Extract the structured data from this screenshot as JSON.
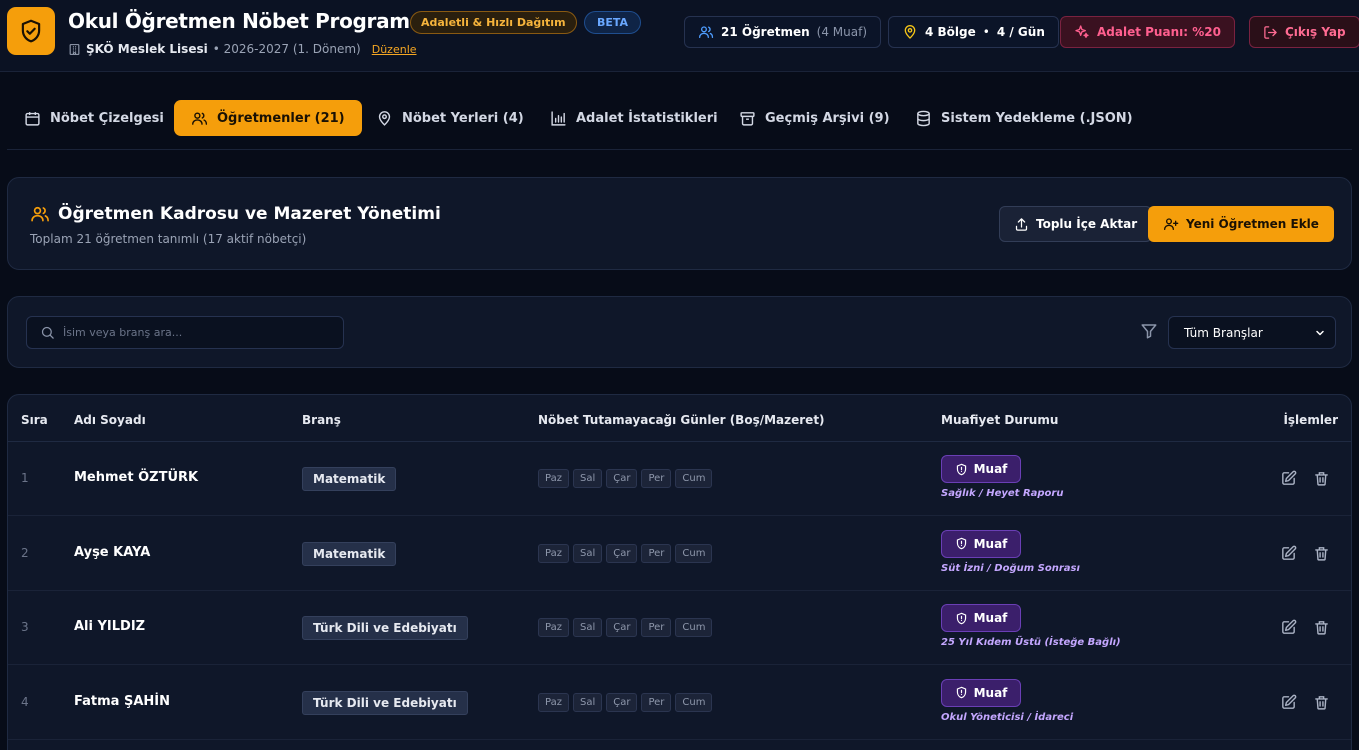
{
  "header": {
    "title": "Okul Öğretmen Nöbet Programı",
    "badge_fair": "Adaletli & Hızlı Dağıtım",
    "badge_beta": "BETA",
    "school": "ŞKÖ Meslek Lisesi",
    "year": "• 2026-2027 (1. Dönem)",
    "edit": "Düzenle",
    "stats": {
      "teachers_count": "21 Öğretmen",
      "teachers_exempt": "(4 Muaf)",
      "zones_count": "4 Bölge",
      "zones_sep": "•",
      "per_day": "4 / Gün",
      "fairness": "Adalet Puanı: %20"
    },
    "logout": "Çıkış Yap"
  },
  "tabs": [
    {
      "label": "Nöbet Çizelgesi",
      "icon": "calendar-icon"
    },
    {
      "label": "Öğretmenler (21)",
      "icon": "users-icon",
      "active": true
    },
    {
      "label": "Nöbet Yerleri (4)",
      "icon": "map-pin-icon"
    },
    {
      "label": "Adalet İstatistikleri",
      "icon": "bar-chart-icon"
    },
    {
      "label": "Geçmiş Arşivi (9)",
      "icon": "archive-icon"
    },
    {
      "label": "Sistem Yedekleme (.JSON)",
      "icon": "database-icon"
    }
  ],
  "section": {
    "title": "Öğretmen Kadrosu ve Mazeret Yönetimi",
    "subtitle": "Toplam 21 öğretmen tanımlı (17 aktif nöbetçi)",
    "import_btn": "Toplu İçe Aktar",
    "add_btn": "Yeni Öğretmen Ekle"
  },
  "filter": {
    "search_placeholder": "İsim veya branş ara...",
    "search_value": "",
    "branch_selected": "Tüm Branşlar"
  },
  "table": {
    "headers": {
      "idx": "Sıra",
      "name": "Adı Soyadı",
      "branch": "Branş",
      "days": "Nöbet Tutamayacağı Günler (Boş/Mazeret)",
      "exempt": "Muafiyet Durumu",
      "actions": "İşlemler"
    },
    "days": [
      "Paz",
      "Sal",
      "Çar",
      "Per",
      "Cum"
    ],
    "rows": [
      {
        "idx": "1",
        "name": "Mehmet ÖZTÜRK",
        "branch": "Matematik",
        "status": "Muaf",
        "reason": "Sağlık / Heyet Raporu"
      },
      {
        "idx": "2",
        "name": "Ayşe KAYA",
        "branch": "Matematik",
        "status": "Muaf",
        "reason": "Süt İzni / Doğum Sonrası"
      },
      {
        "idx": "3",
        "name": "Ali YILDIZ",
        "branch": "Türk Dili ve Edebiyatı",
        "status": "Muaf",
        "reason": "25 Yıl Kıdem Üstü (İsteğe Bağlı)"
      },
      {
        "idx": "4",
        "name": "Fatma ŞAHİN",
        "branch": "Türk Dili ve Edebiyatı",
        "status": "Muaf",
        "reason": "Okul Yöneticisi / İdareci"
      }
    ]
  },
  "colors": {
    "accent": "#f59e0b",
    "background": "#070c18",
    "card": "#0f1729",
    "danger": "#ff5f8f",
    "exempt_purple": "#3b1f6b"
  }
}
